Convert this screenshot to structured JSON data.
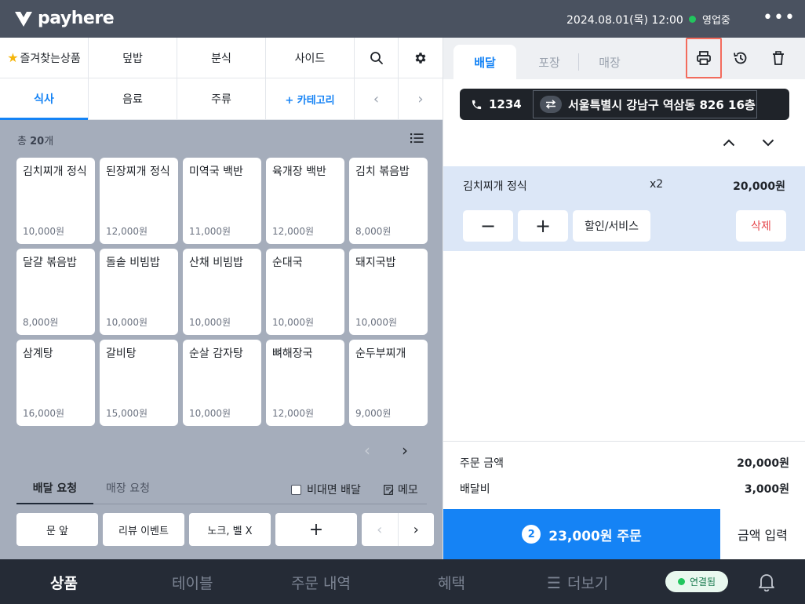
{
  "topbar": {
    "logo": "payhere",
    "datetime": "2024.08.01(목) 12:00",
    "status": "영업중"
  },
  "categories": {
    "row1": [
      "즐겨찾는상품",
      "덮밥",
      "분식",
      "사이드"
    ],
    "row2": [
      "식사",
      "음료",
      "주류",
      "+ 카테고리"
    ],
    "active": "식사"
  },
  "product_list": {
    "total_prefix": "총",
    "total_count": "20",
    "total_suffix": "개",
    "items": [
      {
        "name": "김치찌개 정식",
        "price": "10,000원"
      },
      {
        "name": "된장찌개 정식",
        "price": "12,000원"
      },
      {
        "name": "미역국 백반",
        "price": "11,000원"
      },
      {
        "name": "육개장 백반",
        "price": "12,000원"
      },
      {
        "name": "김치 볶음밥",
        "price": "8,000원"
      },
      {
        "name": "달걀 볶음밥",
        "price": "8,000원"
      },
      {
        "name": "돌솥 비빔밥",
        "price": "10,000원"
      },
      {
        "name": "산채 비빔밥",
        "price": "10,000원"
      },
      {
        "name": "순대국",
        "price": "10,000원"
      },
      {
        "name": "돼지국밥",
        "price": "10,000원"
      },
      {
        "name": "삼계탕",
        "price": "16,000원"
      },
      {
        "name": "갈비탕",
        "price": "15,000원"
      },
      {
        "name": "순살 감자탕",
        "price": "10,000원"
      },
      {
        "name": "뼈해장국",
        "price": "12,000원"
      },
      {
        "name": "순두부찌개",
        "price": "9,000원"
      }
    ]
  },
  "requests": {
    "tab_delivery": "배달 요청",
    "tab_store": "매장 요청",
    "contactless": "비대면 배달",
    "memo": "메모",
    "presets": [
      "문 앞",
      "리뷰 이벤트",
      "노크, 벨 X"
    ],
    "add": "+"
  },
  "order": {
    "tabs": [
      "배달",
      "포장",
      "매장"
    ],
    "active_tab": "배달",
    "phone": "1234",
    "address": "서울특별시 강남구 역삼동 826 16층",
    "line_item": {
      "name": "김치찌개 정식",
      "qty": "x2",
      "price": "20,000원",
      "minus": "−",
      "plus": "+",
      "discount": "할인/서비스",
      "delete": "삭제"
    },
    "order_amount_label": "주문 금액",
    "order_amount": "20,000원",
    "delivery_fee_label": "배달비",
    "delivery_fee": "3,000원",
    "item_count": "2",
    "submit_label": "23,000원 주문",
    "amount_input": "금액 입력"
  },
  "bottom_nav": {
    "items": [
      "상품",
      "테이블",
      "주문 내역",
      "혜택",
      "더보기"
    ],
    "active": "상품",
    "connection": "연결됨"
  },
  "colors": {
    "accent": "#1583f5",
    "topbar": "#4a5260",
    "bottom_nav": "#252b36",
    "highlight": "#f36b5c"
  }
}
